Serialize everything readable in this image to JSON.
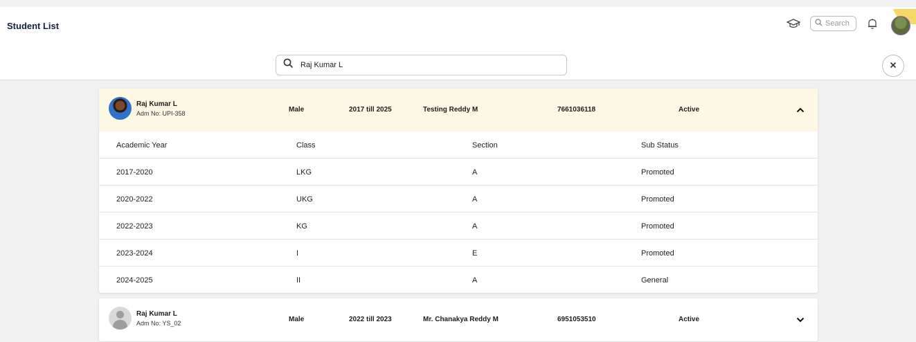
{
  "header": {
    "title": "Student List",
    "mini_search_placeholder": "Search"
  },
  "search": {
    "value": "Raj Kumar L"
  },
  "history_headers": {
    "year": "Academic Year",
    "class": "Class",
    "section": "Section",
    "sub_status": "Sub Status"
  },
  "students": [
    {
      "name": "Raj Kumar L",
      "adm_no": "Adm No: UPI-358",
      "gender": "Male",
      "years": "2017 till 2025",
      "parent": "Testing Reddy M",
      "phone": "7661036118",
      "status": "Active",
      "expanded": true,
      "history": [
        {
          "year": "2017-2020",
          "class": "LKG",
          "section": "A",
          "sub_status": "Promoted"
        },
        {
          "year": "2020-2022",
          "class": "UKG",
          "section": "A",
          "sub_status": "Promoted"
        },
        {
          "year": "2022-2023",
          "class": "KG",
          "section": "A",
          "sub_status": "Promoted"
        },
        {
          "year": "2023-2024",
          "class": "I",
          "section": "E",
          "sub_status": "Promoted"
        },
        {
          "year": "2024-2025",
          "class": "II",
          "section": "A",
          "sub_status": "General"
        }
      ]
    },
    {
      "name": "Raj Kumar L",
      "adm_no": "Adm No: YS_02",
      "gender": "Male",
      "years": "2022 till 2023",
      "parent": "Mr. Chanakya Reddy M",
      "phone": "6951053510",
      "status": "Active",
      "expanded": false
    }
  ],
  "colors": {
    "expanded_row_bg": "#fdf8e3",
    "page_bg": "#f1f1f1",
    "title": "#14213d"
  }
}
